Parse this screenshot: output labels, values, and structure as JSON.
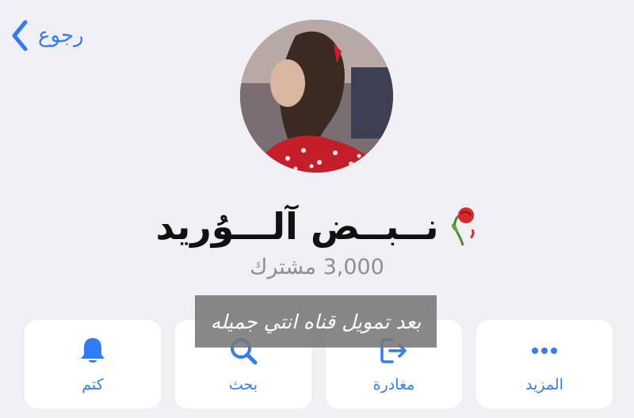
{
  "header": {
    "back_label": "رجوع"
  },
  "channel": {
    "name": "نــبــض آلـــوُريد",
    "subscribers": "3,000 مشترك"
  },
  "actions": [
    {
      "label": "كتم",
      "icon": "bell-icon"
    },
    {
      "label": "بحث",
      "icon": "search-icon"
    },
    {
      "label": "مغادرة",
      "icon": "leave-icon"
    },
    {
      "label": "المزيد",
      "icon": "more-icon"
    }
  ],
  "overlay": {
    "text": "بعد تمويل قناه انتي جميله"
  },
  "colors": {
    "accent": "#2f7cf6",
    "background": "#efeff4",
    "card": "#ffffff"
  }
}
